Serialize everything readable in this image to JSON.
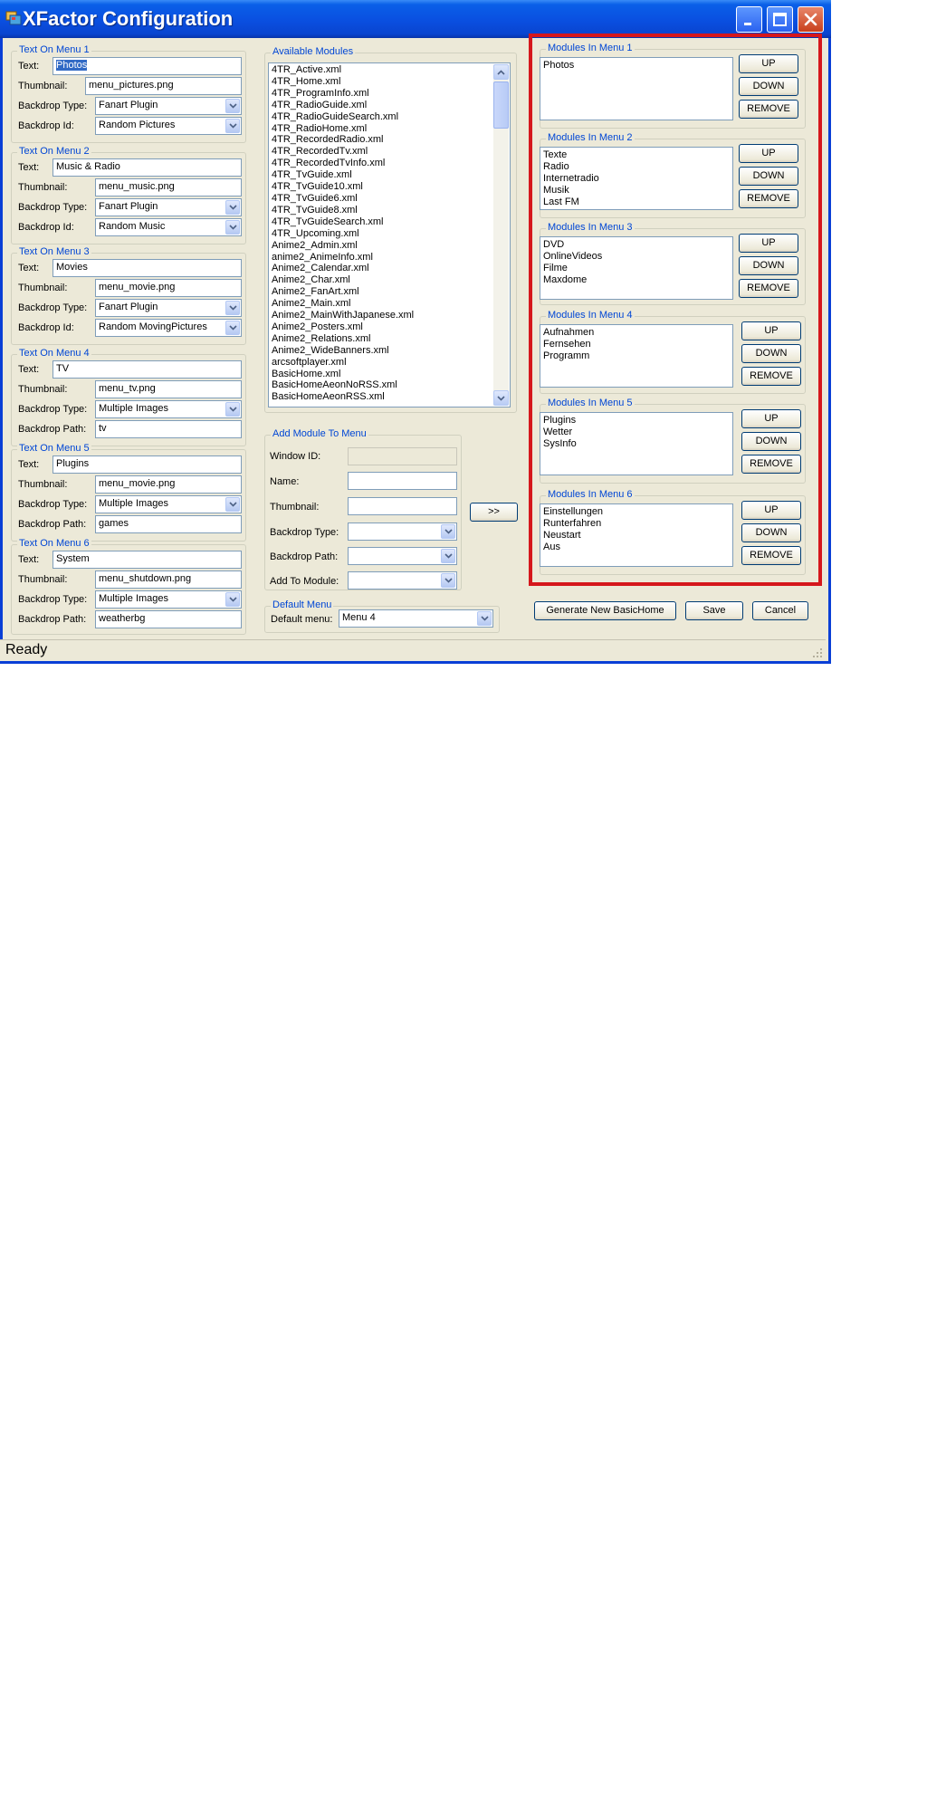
{
  "window": {
    "title": "XFactor Configuration"
  },
  "labels": {
    "text": "Text:",
    "thumbnail": "Thumbnail:",
    "backdrop_type": "Backdrop Type:",
    "backdrop_id": "Backdrop Id:",
    "backdrop_path": "Backdrop Path:"
  },
  "menus": [
    {
      "title": "Text On Menu 1",
      "text": "Photos",
      "thumbnail": "menu_pictures.png",
      "backdrop_type": "Fanart Plugin",
      "last_label": "Backdrop Id:",
      "last_value": "Random Pictures"
    },
    {
      "title": "Text On Menu 2",
      "text": "Music & Radio",
      "thumbnail": "menu_music.png",
      "backdrop_type": "Fanart Plugin",
      "last_label": "Backdrop Id:",
      "last_value": "Random Music"
    },
    {
      "title": "Text On Menu 3",
      "text": "Movies",
      "thumbnail": "menu_movie.png",
      "backdrop_type": "Fanart Plugin",
      "last_label": "Backdrop Id:",
      "last_value": "Random MovingPictures"
    },
    {
      "title": "Text On Menu 4",
      "text": "TV",
      "thumbnail": "menu_tv.png",
      "backdrop_type": "Multiple Images",
      "last_label": "Backdrop Path:",
      "last_value": "tv"
    },
    {
      "title": "Text On Menu 5",
      "text": "Plugins",
      "thumbnail": "menu_movie.png",
      "backdrop_type": "Multiple Images",
      "last_label": "Backdrop Path:",
      "last_value": "games"
    },
    {
      "title": "Text On Menu 6",
      "text": "System",
      "thumbnail": "menu_shutdown.png",
      "backdrop_type": "Multiple Images",
      "last_label": "Backdrop Path:",
      "last_value": "weatherbg"
    }
  ],
  "available": {
    "title": "Available Modules",
    "items": [
      "4TR_Active.xml",
      "4TR_Home.xml",
      "4TR_ProgramInfo.xml",
      "4TR_RadioGuide.xml",
      "4TR_RadioGuideSearch.xml",
      "4TR_RadioHome.xml",
      "4TR_RecordedRadio.xml",
      "4TR_RecordedTv.xml",
      "4TR_RecordedTvInfo.xml",
      "4TR_TvGuide.xml",
      "4TR_TvGuide10.xml",
      "4TR_TvGuide6.xml",
      "4TR_TvGuide8.xml",
      "4TR_TvGuideSearch.xml",
      "4TR_Upcoming.xml",
      "Anime2_Admin.xml",
      "anime2_AnimeInfo.xml",
      "Anime2_Calendar.xml",
      "Anime2_Char.xml",
      "Anime2_FanArt.xml",
      "Anime2_Main.xml",
      "Anime2_MainWithJapanese.xml",
      "Anime2_Posters.xml",
      "Anime2_Relations.xml",
      "Anime2_WideBanners.xml",
      "arcsoftplayer.xml",
      "BasicHome.xml",
      "BasicHomeAeonNoRSS.xml",
      "BasicHomeAeonRSS.xml"
    ]
  },
  "add_module": {
    "title": "Add Module To Menu",
    "window_id_label": "Window ID:",
    "window_id": "",
    "name_label": "Name:",
    "name": "",
    "thumbnail_label": "Thumbnail:",
    "thumbnail": "",
    "backdrop_type_label": "Backdrop Type:",
    "backdrop_type": "",
    "backdrop_path_label": "Backdrop Path:",
    "backdrop_path": "",
    "add_to_label": "Add To Module:",
    "add_to": ""
  },
  "add_button": ">>",
  "default_menu": {
    "title": "Default Menu",
    "label": "Default menu:",
    "value": "Menu 4"
  },
  "module_groups": [
    {
      "title": "Modules In Menu 1",
      "items": [
        "Photos"
      ]
    },
    {
      "title": "Modules In Menu 2",
      "items": [
        "Texte",
        "Radio",
        "Internetradio",
        "Musik",
        "Last FM"
      ]
    },
    {
      "title": "Modules In Menu 3",
      "items": [
        "DVD",
        "OnlineVideos",
        "Filme",
        "Maxdome"
      ]
    },
    {
      "title": "Modules In Menu 4",
      "items": [
        "Aufnahmen",
        "Fernsehen",
        "Programm"
      ]
    },
    {
      "title": "Modules In Menu 5",
      "items": [
        "Plugins",
        "Wetter",
        "SysInfo"
      ]
    },
    {
      "title": "Modules In Menu 6",
      "items": [
        "Einstellungen",
        "Runterfahren",
        "Neustart",
        "Aus"
      ]
    }
  ],
  "buttons": {
    "up": "UP",
    "down": "DOWN",
    "remove": "REMOVE",
    "generate": "Generate New BasicHome",
    "save": "Save",
    "cancel": "Cancel"
  },
  "status": "Ready",
  "colors": {
    "title_bar": "#0a4fe0",
    "group_title": "#0046d5",
    "highlight_box": "#d5171c",
    "selection": "#316ac5"
  }
}
